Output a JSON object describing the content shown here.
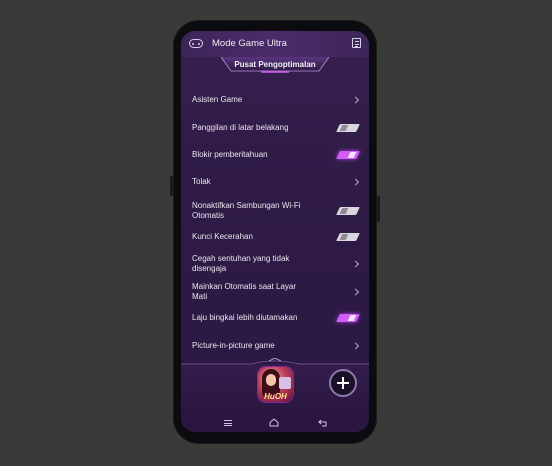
{
  "header": {
    "title": "Mode Game Ultra",
    "left_icon": "gamepad-icon",
    "right_icon": "menu-list-icon"
  },
  "tab": {
    "label": "Pusat Pengoptimalan"
  },
  "settings": [
    {
      "label": "Asisten Game",
      "control": "chevron"
    },
    {
      "label": "Panggilan di latar belakang",
      "control": "toggle",
      "on": false
    },
    {
      "label": "Blokir pemberitahuan",
      "control": "toggle",
      "on": true
    },
    {
      "label": "Tolak",
      "control": "chevron"
    },
    {
      "label": "Nonaktifkan Sambungan Wi-Fi Otomatis",
      "control": "toggle",
      "on": false
    },
    {
      "label": "Kunci Kecerahan",
      "control": "toggle",
      "on": false
    },
    {
      "label": "Cegah sentuhan yang tidak disengaja",
      "control": "chevron"
    },
    {
      "label": "Mainkan Otomatis saat Layar Mati",
      "control": "chevron"
    },
    {
      "label": "Laju bingkai lebih diutamakan",
      "control": "toggle",
      "on": true
    },
    {
      "label": "Picture-in-picture game",
      "control": "chevron"
    }
  ],
  "dock": {
    "game_app_logo": "HuOH",
    "add_icon": "plus-icon"
  },
  "navbar": {
    "icons": [
      "menu-icon",
      "home-icon",
      "back-icon"
    ]
  },
  "colors": {
    "background": "#3a3b39",
    "screen": "#2f1b46",
    "accent": "#d15cf6"
  }
}
